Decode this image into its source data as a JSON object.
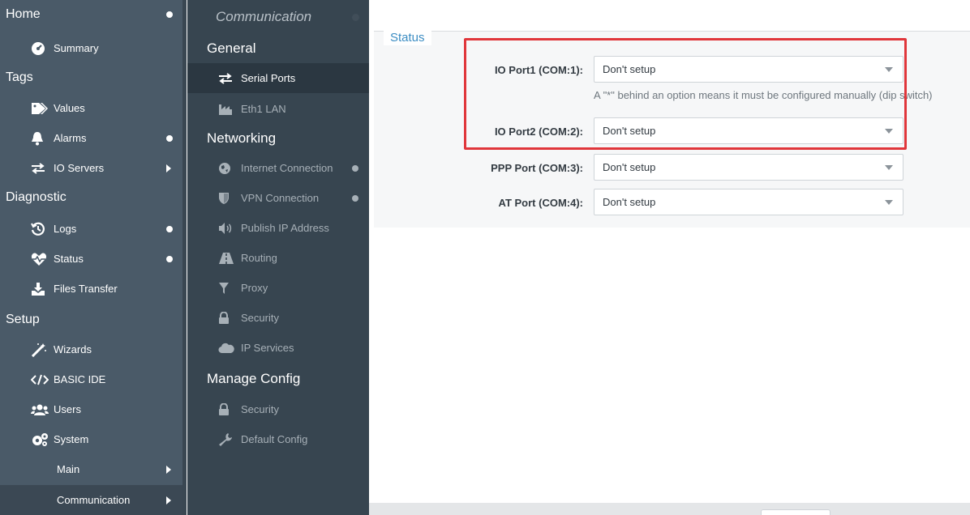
{
  "sidebar": {
    "sections": [
      {
        "label": "Home"
      },
      {
        "label": "Tags"
      },
      {
        "label": "Diagnostic"
      },
      {
        "label": "Setup"
      }
    ],
    "items": [
      {
        "label": "Summary",
        "icon": "dashboard-icon"
      },
      {
        "label": "Values",
        "icon": "tag-icon"
      },
      {
        "label": "Alarms",
        "icon": "bell-icon"
      },
      {
        "label": "IO Servers",
        "icon": "exchange-icon"
      },
      {
        "label": "Logs",
        "icon": "history-icon"
      },
      {
        "label": "Status",
        "icon": "heartbeat-icon"
      },
      {
        "label": "Files Transfer",
        "icon": "download-icon"
      },
      {
        "label": "Wizards",
        "icon": "magic-wand-icon"
      },
      {
        "label": "BASIC IDE",
        "icon": "code-icon"
      },
      {
        "label": "Users",
        "icon": "users-icon"
      },
      {
        "label": "System",
        "icon": "gears-icon"
      },
      {
        "label": "Main"
      },
      {
        "label": "Communication"
      }
    ]
  },
  "midnav": {
    "title": "Communication",
    "sections": [
      {
        "label": "General"
      },
      {
        "label": "Networking"
      },
      {
        "label": "Manage Config"
      }
    ],
    "items": [
      {
        "label": "Serial Ports",
        "icon": "exchange-icon"
      },
      {
        "label": "Eth1 LAN",
        "icon": "industry-icon"
      },
      {
        "label": "Internet Connection",
        "icon": "globe-icon"
      },
      {
        "label": "VPN Connection",
        "icon": "shield-icon"
      },
      {
        "label": "Publish IP Address",
        "icon": "volume-icon"
      },
      {
        "label": "Routing",
        "icon": "road-icon"
      },
      {
        "label": "Proxy",
        "icon": "filter-icon"
      },
      {
        "label": "Security",
        "icon": "lock-icon"
      },
      {
        "label": "IP Services",
        "icon": "cloud-icon"
      },
      {
        "label": "Security",
        "icon": "lock-icon"
      },
      {
        "label": "Default Config",
        "icon": "wrench-icon"
      }
    ]
  },
  "main": {
    "legend": "Status",
    "fields": [
      {
        "label": "IO Port1 (COM:1):",
        "value": "Don't setup"
      },
      {
        "label": "IO Port2 (COM:2):",
        "value": "Don't setup"
      },
      {
        "label": "PPP Port (COM:3):",
        "value": "Don't setup"
      },
      {
        "label": "AT Port (COM:4):",
        "value": "Don't setup"
      }
    ],
    "hint": "A \"*\" behind an option means it must be configured manually (dip switch)"
  },
  "colors": {
    "sidebar": "#4a5a68",
    "midnav": "#374550",
    "accent": "#3c8dc3",
    "highlight": "#e0363b"
  }
}
